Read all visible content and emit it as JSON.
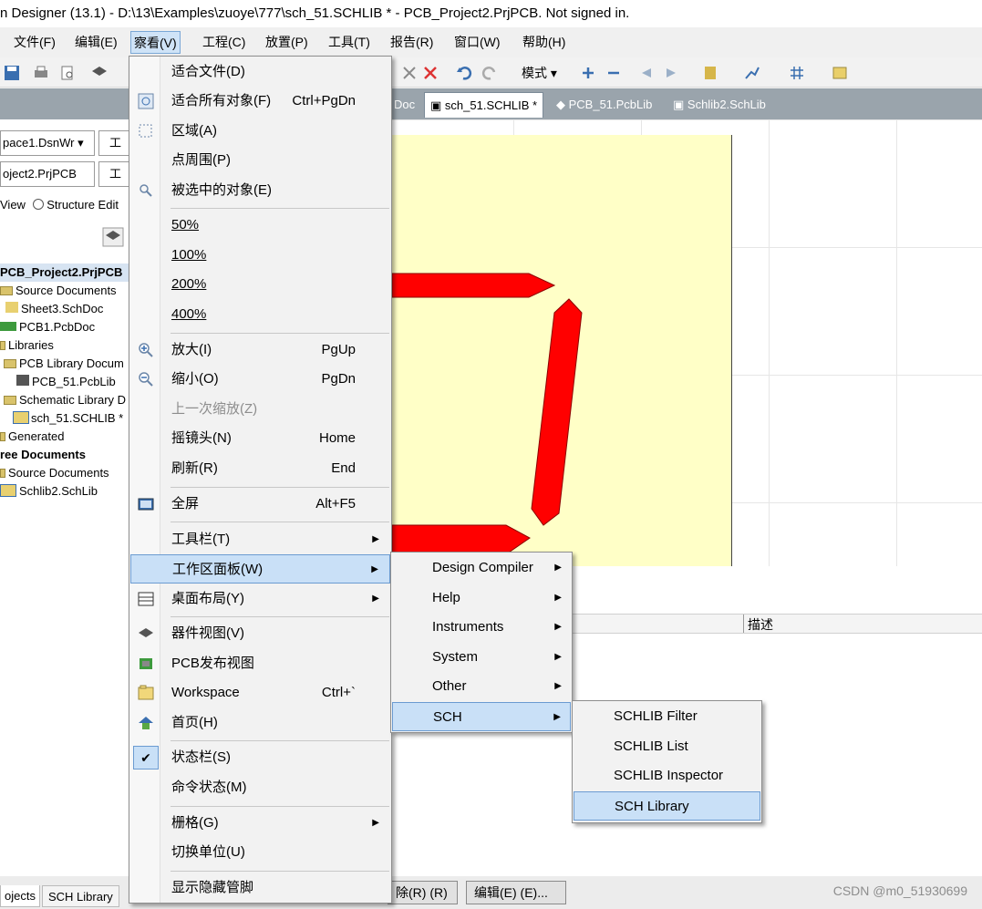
{
  "title": "n Designer (13.1) - D:\\13\\Examples\\zuoye\\777\\sch_51.SCHLIB * - PCB_Project2.PrjPCB. Not signed in.",
  "menubar": {
    "file": "文件(F)",
    "edit": "编辑(E)",
    "view": "察看(V)",
    "project": "工程(C)",
    "place": "放置(P)",
    "tools": "工具(T)",
    "reports": "报告(R)",
    "window": "窗口(W)",
    "help": "帮助(H)"
  },
  "toolbar": {
    "mode_label": "模式"
  },
  "doctabs": {
    "partial": "Doc",
    "active": "sch_51.SCHLIB *",
    "pcb": "PCB_51.PcbLib",
    "schlib2": "Schlib2.SchLib"
  },
  "left_panel": {
    "workspace_combo": "pace1.DsnWr",
    "project_combo": "oject2.PrjPCB",
    "side_button_1": "工",
    "side_button_2": "工",
    "view_radio": "View",
    "structure_radio": "Structure Edit",
    "tree": [
      {
        "label": "PCB_Project2.PrjPCB"
      },
      {
        "label": "Source Documents"
      },
      {
        "label": "Sheet3.SchDoc"
      },
      {
        "label": "PCB1.PcbDoc"
      },
      {
        "label": "Libraries"
      },
      {
        "label": "PCB Library Docum"
      },
      {
        "label": "PCB_51.PcbLib"
      },
      {
        "label": "Schematic Library D"
      },
      {
        "label": "sch_51.SCHLIB *"
      },
      {
        "label": "Generated"
      },
      {
        "label": "ree Documents"
      },
      {
        "label": "Source Documents"
      },
      {
        "label": "Schlib2.SchLib"
      }
    ],
    "bottom_tabs": {
      "projects": "ojects",
      "sch_library": "SCH Library"
    }
  },
  "lower_panel": {
    "desc_header": "描述"
  },
  "bottom_buttons": {
    "delete": "除(R) (R)",
    "edit": "编辑(E) (E)..."
  },
  "view_menu": {
    "items": [
      {
        "label": "适合文件(D)",
        "shortcut": ""
      },
      {
        "label": "适合所有对象(F)",
        "shortcut": "Ctrl+PgDn"
      },
      {
        "label": "区域(A)",
        "shortcut": ""
      },
      {
        "label": "点周围(P)",
        "shortcut": ""
      },
      {
        "label": "被选中的对象(E)",
        "shortcut": ""
      },
      {
        "label": "50%",
        "shortcut": ""
      },
      {
        "label": "100%",
        "shortcut": ""
      },
      {
        "label": "200%",
        "shortcut": ""
      },
      {
        "label": "400%",
        "shortcut": ""
      },
      {
        "label": "放大(I)",
        "shortcut": "PgUp"
      },
      {
        "label": "缩小(O)",
        "shortcut": "PgDn"
      },
      {
        "label": "上一次缩放(Z)",
        "shortcut": ""
      },
      {
        "label": "摇镜头(N)",
        "shortcut": "Home"
      },
      {
        "label": "刷新(R)",
        "shortcut": "End"
      },
      {
        "label": "全屏",
        "shortcut": "Alt+F5"
      },
      {
        "label": "工具栏(T)",
        "shortcut": ""
      },
      {
        "label": "工作区面板(W)",
        "shortcut": ""
      },
      {
        "label": "桌面布局(Y)",
        "shortcut": ""
      },
      {
        "label": "器件视图(V)",
        "shortcut": ""
      },
      {
        "label": "PCB发布视图",
        "shortcut": ""
      },
      {
        "label": "Workspace",
        "shortcut": "Ctrl+`"
      },
      {
        "label": "首页(H)",
        "shortcut": ""
      },
      {
        "label": "状态栏(S)",
        "shortcut": ""
      },
      {
        "label": "命令状态(M)",
        "shortcut": ""
      },
      {
        "label": "栅格(G)",
        "shortcut": ""
      },
      {
        "label": "切换单位(U)",
        "shortcut": ""
      },
      {
        "label": "显示隐藏管脚",
        "shortcut": ""
      }
    ]
  },
  "workspace_panels_menu": {
    "items": [
      {
        "label": "Design Compiler"
      },
      {
        "label": "Help"
      },
      {
        "label": "Instruments"
      },
      {
        "label": "System"
      },
      {
        "label": "Other"
      },
      {
        "label": "SCH"
      }
    ]
  },
  "sch_menu": {
    "items": [
      {
        "label": "SCHLIB Filter"
      },
      {
        "label": "SCHLIB List"
      },
      {
        "label": "SCHLIB Inspector"
      },
      {
        "label": "SCH Library"
      }
    ]
  },
  "watermark": "CSDN @m0_51930699",
  "colors": {
    "canvas_sheet": "#ffffc7",
    "segment_fill": "#ff0000",
    "menu_highlight": "#c9e0f7",
    "tree_selected": "#0a64d6"
  }
}
